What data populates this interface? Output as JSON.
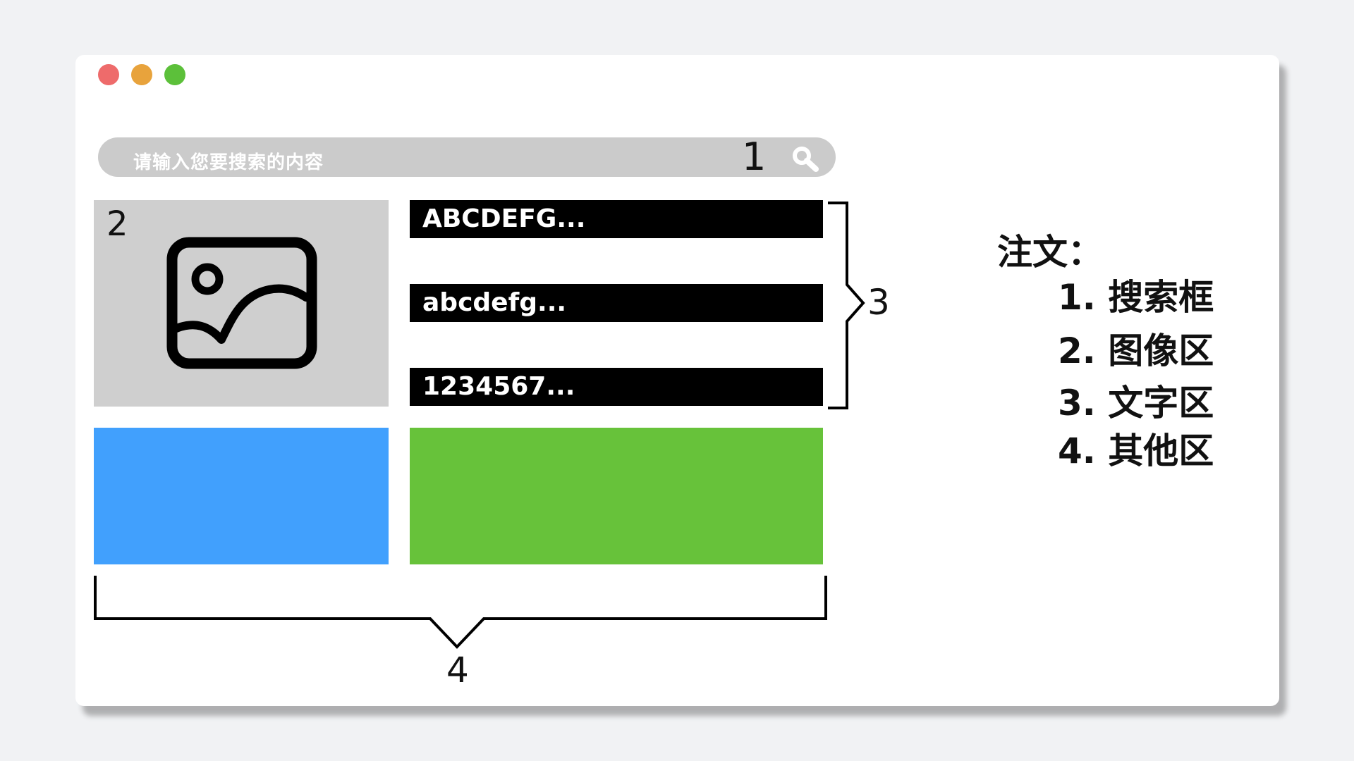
{
  "window_controls": {
    "close_color": "#ee6b6b",
    "minimize_color": "#e8a33c",
    "maximize_color": "#5cc03a"
  },
  "search": {
    "placeholder": "请输入您要搜索的内容",
    "callout_number": "1",
    "icon": "search-icon"
  },
  "image_area": {
    "callout_number": "2",
    "icon": "image-placeholder-icon"
  },
  "text_area": {
    "lines": [
      "ABCDEFG...",
      "abcdefg...",
      "1234567..."
    ],
    "callout_number": "3"
  },
  "other_area": {
    "callout_number": "4",
    "block_colors": [
      "#41a0fd",
      "#67c23a"
    ]
  },
  "notes": {
    "title": "注文：",
    "items": [
      "1. 搜索框",
      "2. 图像区",
      "3. 文字区",
      "4. 其他区"
    ]
  }
}
